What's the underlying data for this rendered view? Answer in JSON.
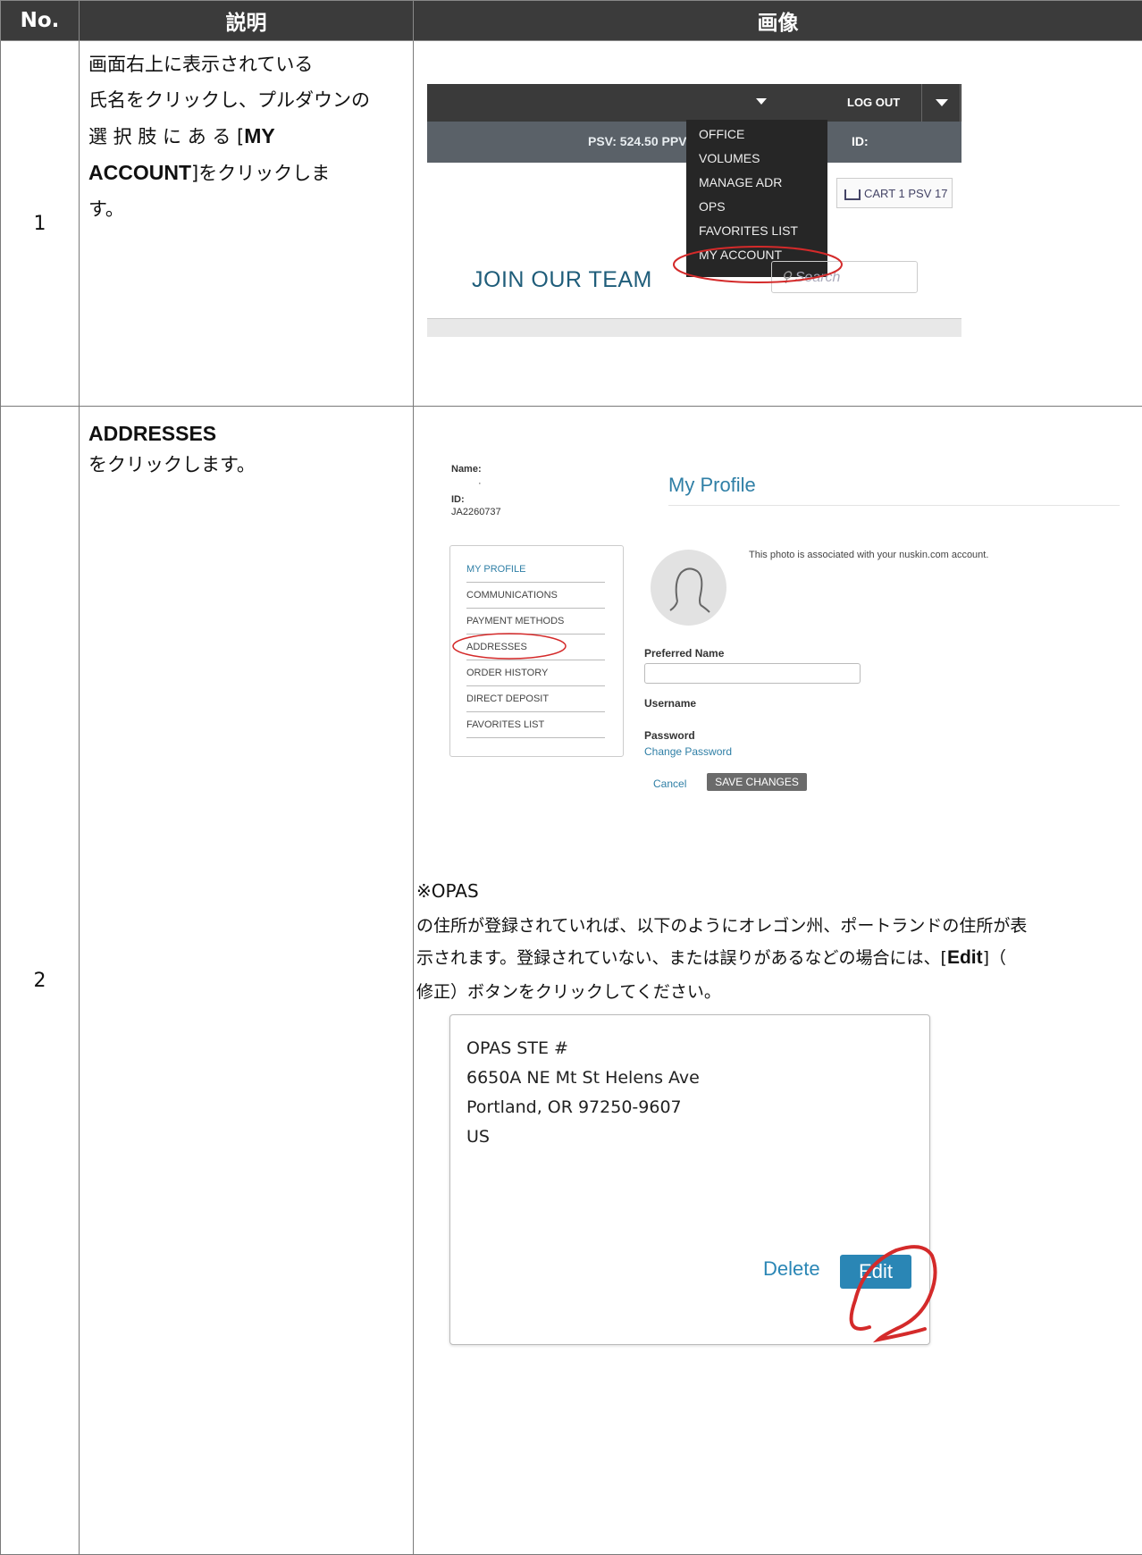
{
  "table": {
    "headers": {
      "no": "No.",
      "desc": "説明",
      "image": "画像"
    }
  },
  "step1": {
    "no": "1",
    "desc_lines": [
      "画面右上に表示されている",
      "氏名をクリックし、プルダウンの"
    ],
    "desc_pre": "選 択 肢 に あ る [",
    "desc_bold1": "MY",
    "desc_bold2": "ACCOUNT",
    "desc_post": "]をクリックしま",
    "desc_last": "す。",
    "shot": {
      "logout": "LOG OUT",
      "psv": "PSV: 524.50  PPV",
      "id_label": "ID:",
      "menu": [
        "OFFICE",
        "VOLUMES",
        "MANAGE ADR",
        "OPS",
        "FAVORITES LIST",
        "MY ACCOUNT"
      ],
      "cart": "CART 1 PSV 17",
      "join": "JOIN OUR TEAM",
      "search": "Search"
    }
  },
  "step2": {
    "no": "2",
    "desc_bold": "ADDRESSES",
    "desc_rest": "をクリックします。",
    "profile": {
      "name_label": "Name:",
      "name_value": "·",
      "id_label": "ID:",
      "id_value": "JA2260737",
      "title": "My Profile",
      "photo_note": "This photo is associated with your nuskin.com account.",
      "menu": [
        "MY PROFILE",
        "COMMUNICATIONS",
        "PAYMENT METHODS",
        "ADDRESSES",
        "ORDER HISTORY",
        "DIRECT DEPOSIT",
        "FAVORITES LIST"
      ],
      "preferred_name_label": "Preferred Name",
      "username_label": "Username",
      "password_label": "Password",
      "change_password": "Change Password",
      "cancel": "Cancel",
      "save": "SAVE CHANGES"
    },
    "note": {
      "heading": "※OPAS",
      "line1": "の住所が登録されていれば、以下のようにオレゴン州、ポートランドの住所が表",
      "line2_pre": "示されます。登録されていない、または誤りがあるなどの場合には、[",
      "line2_bold": "Edit",
      "line2_post": "]（",
      "line3": "修正）ボタンをクリックしてください。"
    },
    "address": {
      "lines": [
        "OPAS STE #",
        "6650A NE Mt St Helens Ave",
        "Portland, OR 97250-9607",
        "US"
      ],
      "delete": "Delete",
      "edit": "Edit"
    }
  },
  "colors": {
    "header_bg": "#3b3b3b",
    "accent_blue": "#2a86b5",
    "annotation_red": "#d42a2a"
  }
}
